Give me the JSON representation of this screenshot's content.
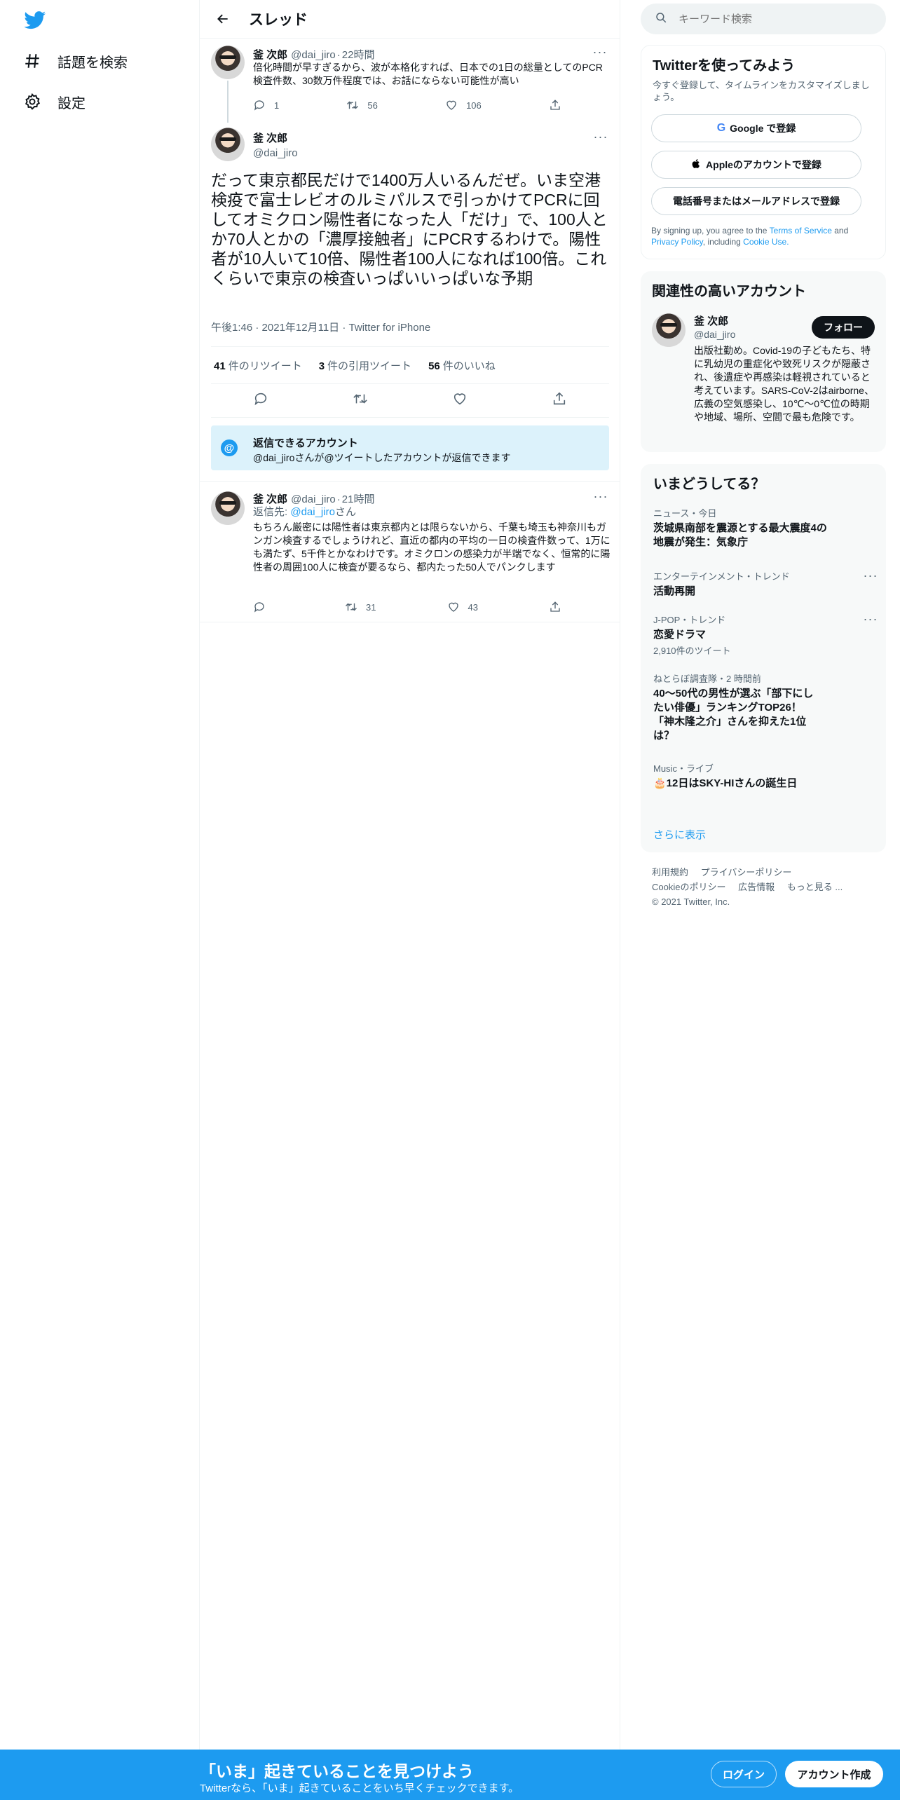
{
  "nav": {
    "explore_label": "話題を検索",
    "settings_label": "設定"
  },
  "header": {
    "title": "スレッド"
  },
  "tweets": [
    {
      "name": "釜 次郎",
      "handle": "@dai_jiro",
      "time": "22時間",
      "text": "倍化時間が早すぎるから、波が本格化すれば、日本での1日の総量としてのPCR検査件数、30数万件程度では、お話にならない可能性が高い",
      "replies": "1",
      "retweets": "56",
      "likes": "106"
    }
  ],
  "focus": {
    "name": "釜 次郎",
    "handle": "@dai_jiro",
    "text": "だって東京都民だけで1400万人いるんだぜ。いま空港検疫で富士レビオのルミパルスで引っかけてPCRに回してオミクロン陽性者になった人「だけ」で、100人とか70人とかの「濃厚接触者」にPCRするわけで。陽性者が10人いて10倍、陽性者100人になれば100倍。これくらいで東京の検査いっぱいいっぱいな予期",
    "time": "午後1:46",
    "date": "2021年12月11日",
    "client": "Twitter for iPhone",
    "retweets_count": "41",
    "retweets_label": "件のリツイート",
    "quotes_count": "3",
    "quotes_label": "件の引用ツイート",
    "likes_count": "56",
    "likes_label": "件のいいね"
  },
  "reply_restriction": {
    "title": "返信できるアカウント",
    "desc": "@dai_jiroさんが@ツイートしたアカウントが返信できます"
  },
  "reply": {
    "name": "釜 次郎",
    "handle": "@dai_jiro",
    "time": "21時間",
    "replying_to_prefix": "返信先: ",
    "replying_to_handle": "@dai_jiro",
    "replying_to_suffix": "さん",
    "text": "もちろん厳密には陽性者は東京都内とは限らないから、千葉も埼玉も神奈川もガンガン検査するでしょうけれど、直近の都内の平均の一日の検査件数って、1万にも満たず、5千件とかなわけです。オミクロンの感染力が半端でなく、恒常的に陽性者の周囲100人に検査が要るなら、都内たった50人でパンクします",
    "replies": "",
    "retweets": "31",
    "likes": "43"
  },
  "search": {
    "placeholder": "キーワード検索"
  },
  "signup_panel": {
    "title": "Twitterを使ってみよう",
    "subtitle": "今すぐ登録して、タイムラインをカスタマイズしましょう。",
    "google": "Google で登録",
    "apple": "Appleのアカウントで登録",
    "phone": "電話番号またはメールアドレスで登録",
    "terms_prefix": "By signing up, you agree to the ",
    "terms": "Terms of Service",
    "and": " and ",
    "privacy": "Privacy Policy",
    "including": ", including ",
    "cookie": "Cookie Use."
  },
  "related": {
    "title": "関連性の高いアカウント",
    "name": "釜 次郎",
    "handle": "@dai_jiro",
    "follow": "フォロー",
    "bio": "出版社勤め。Covid-19の子どもたち、特に乳幼児の重症化や致死リスクが隠蔽され、後遺症や再感染は軽視されていると考えています。SARS-CoV-2はairborne、広義の空気感染し、10℃〜0℃位の時期や地域、場所、空間で最も危険です。"
  },
  "trends": {
    "title": "いまどうしてる？",
    "items": [
      {
        "category": "ニュース・今日",
        "title": "茨城県南部を震源とする最大震度4の地震が発生：気象庁",
        "count": ""
      },
      {
        "category": "エンターテインメント・トレンド",
        "title": "活動再開",
        "count": ""
      },
      {
        "category": "J-POP・トレンド",
        "title": "恋愛ドラマ",
        "count": "2,910件のツイート"
      },
      {
        "category": "ねとらぼ調査隊・2 時間前",
        "title": "40～50代の男性が選ぶ「部下にしたい俳優」ランキングTOP26！「神木隆之介」さんを抑えた1位は？",
        "count": ""
      },
      {
        "category": "Music・ライブ",
        "title": "🎂12日はSKY-HIさんの誕生日",
        "count": ""
      }
    ],
    "show_more": "さらに表示"
  },
  "footer": {
    "terms": "利用規約",
    "privacy": "プライバシーポリシー",
    "cookie": "Cookieのポリシー",
    "ads": "広告情報",
    "more": "もっと見る ...",
    "copyright": "© 2021 Twitter, Inc."
  },
  "bottom_bar": {
    "headline": "「いま」起きていることを見つけよう",
    "sub": "Twitterなら、「いま」起きていることをいち早くチェックできます。",
    "login": "ログイン",
    "signup": "アカウント作成"
  },
  "colors": {
    "accent": "#1d9bf0",
    "text": "#0f1419",
    "muted": "#536471",
    "reply_box_bg": "#dcf2fb"
  }
}
